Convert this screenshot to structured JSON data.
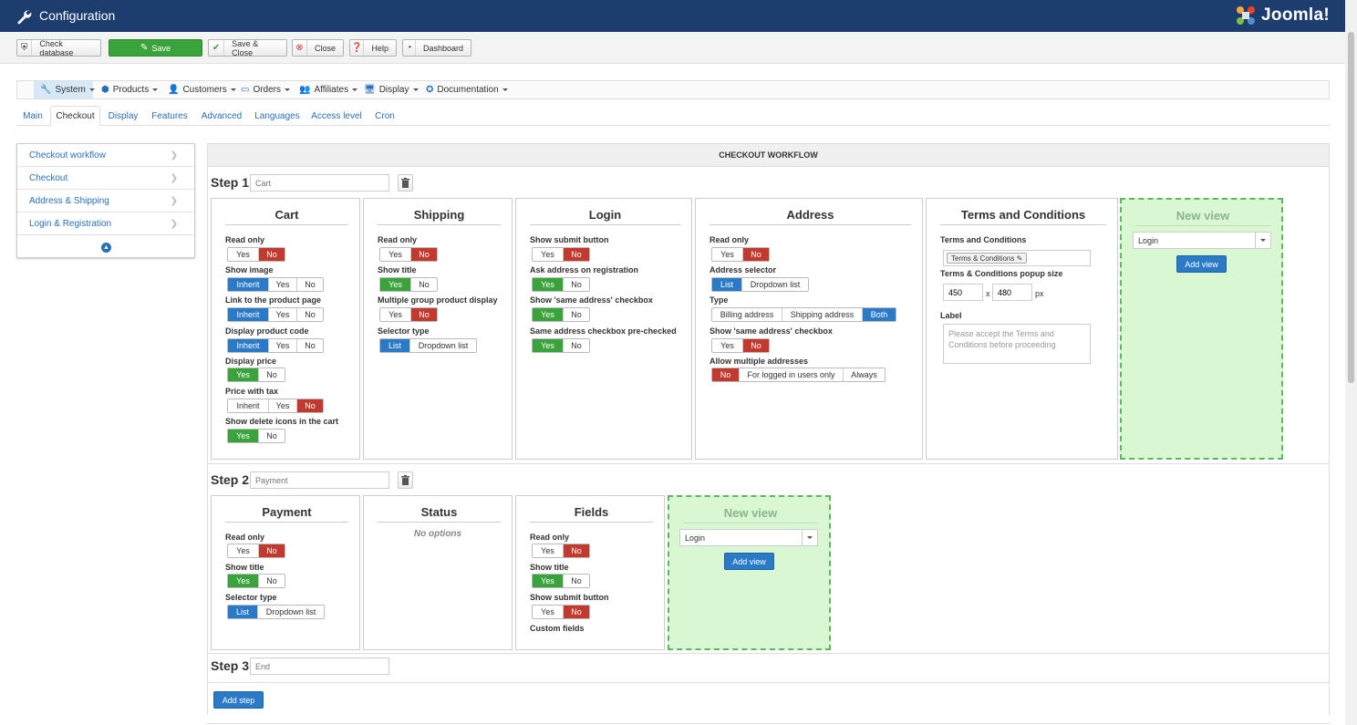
{
  "app": {
    "title": "Configuration",
    "brand": "Joomla!",
    "brand_word": "Joomla!"
  },
  "toolbar": {
    "check_database": "Check database",
    "save": "Save",
    "save_close": "Save & Close",
    "close": "Close",
    "help": "Help",
    "dashboard": "Dashboard"
  },
  "menu": {
    "items": [
      {
        "label": "System",
        "icon": "wrench-icon"
      },
      {
        "label": "Products",
        "icon": "cubes-icon"
      },
      {
        "label": "Customers",
        "icon": "user-icon"
      },
      {
        "label": "Orders",
        "icon": "credit-card-icon"
      },
      {
        "label": "Affiliates",
        "icon": "users-icon"
      },
      {
        "label": "Display",
        "icon": "desktop-icon"
      },
      {
        "label": "Documentation",
        "icon": "life-ring-icon"
      }
    ]
  },
  "tabs": [
    "Main",
    "Checkout",
    "Display",
    "Features",
    "Advanced",
    "Languages",
    "Access level",
    "Cron"
  ],
  "leftnav": [
    "Checkout workflow",
    "Checkout",
    "Address & Shipping",
    "Login & Registration"
  ],
  "workflow": {
    "header": "CHECKOUT WORKFLOW",
    "steps": [
      {
        "label": "Step 1",
        "placeholder": "Cart"
      },
      {
        "label": "Step 2",
        "placeholder": "Payment"
      },
      {
        "label": "Step 3",
        "placeholder": "End"
      }
    ],
    "add_step": "Add step"
  },
  "cards": {
    "cart": {
      "title": "Cart",
      "fields": [
        {
          "label": "Read only",
          "options": [
            "Yes",
            "No"
          ]
        },
        {
          "label": "Show image",
          "options": [
            "Inherit",
            "Yes",
            "No"
          ]
        },
        {
          "label": "Link to the product page",
          "options": [
            "Inherit",
            "Yes",
            "No"
          ]
        },
        {
          "label": "Display product code",
          "options": [
            "Inherit",
            "Yes",
            "No"
          ]
        },
        {
          "label": "Display price",
          "options": [
            "Yes",
            "No"
          ]
        },
        {
          "label": "Price with tax",
          "options": [
            "Inherit",
            "Yes",
            "No"
          ]
        },
        {
          "label": "Show delete icons in the cart",
          "options": [
            "Yes",
            "No"
          ]
        }
      ]
    },
    "shipping": {
      "title": "Shipping",
      "fields": [
        {
          "label": "Read only",
          "options": [
            "Yes",
            "No"
          ]
        },
        {
          "label": "Show title",
          "options": [
            "Yes",
            "No"
          ]
        },
        {
          "label": "Multiple group product display",
          "options": [
            "Yes",
            "No"
          ]
        },
        {
          "label": "Selector type",
          "options": [
            "List",
            "Dropdown list"
          ]
        }
      ]
    },
    "login": {
      "title": "Login",
      "fields": [
        {
          "label": "Show submit button",
          "options": [
            "Yes",
            "No"
          ]
        },
        {
          "label": "Ask address on registration",
          "options": [
            "Yes",
            "No"
          ]
        },
        {
          "label": "Show 'same address' checkbox",
          "options": [
            "Yes",
            "No"
          ]
        },
        {
          "label": "Same address checkbox pre-checked",
          "options": [
            "Yes",
            "No"
          ]
        }
      ]
    },
    "address": {
      "title": "Address",
      "fields": [
        {
          "label": "Read only",
          "options": [
            "Yes",
            "No"
          ]
        },
        {
          "label": "Address selector",
          "options": [
            "List",
            "Dropdown list"
          ]
        },
        {
          "label": "Type",
          "options": [
            "Billing address",
            "Shipping address",
            "Both"
          ]
        },
        {
          "label": "Show 'same address' checkbox",
          "options": [
            "Yes",
            "No"
          ]
        },
        {
          "label": "Allow multiple addresses",
          "options": [
            "No",
            "For logged in users only",
            "Always"
          ]
        }
      ]
    },
    "terms": {
      "title": "Terms and Conditions",
      "terms_label": "Terms and Conditions",
      "terms_chip": "Terms & Conditions",
      "popup_label": "Terms & Conditions popup size",
      "width": "450",
      "x": "x",
      "height": "480",
      "px": "px",
      "label_label": "Label",
      "label_placeholder": "Please accept the Terms and Conditions before proceeding"
    },
    "newview1": {
      "title": "New view",
      "select": "Login",
      "add": "Add view"
    },
    "payment": {
      "title": "Payment",
      "fields": [
        {
          "label": "Read only",
          "options": [
            "Yes",
            "No"
          ]
        },
        {
          "label": "Show title",
          "options": [
            "Yes",
            "No"
          ]
        },
        {
          "label": "Selector type",
          "options": [
            "List",
            "Dropdown list"
          ]
        }
      ]
    },
    "status": {
      "title": "Status",
      "no_options": "No options"
    },
    "fields": {
      "title": "Fields",
      "fields": [
        {
          "label": "Read only",
          "options": [
            "Yes",
            "No"
          ]
        },
        {
          "label": "Show title",
          "options": [
            "Yes",
            "No"
          ]
        },
        {
          "label": "Show submit button",
          "options": [
            "Yes",
            "No"
          ]
        }
      ],
      "custom_fields": "Custom fields"
    },
    "newview2": {
      "title": "New view",
      "select": "Login",
      "add": "Add view"
    }
  },
  "colors": {
    "header_bg": "#1c3d6e",
    "selected_blue": "#2a7ac8",
    "selected_red": "#c23a2f",
    "selected_green": "#3ba33b",
    "new_view_bg": "#d9f7d2",
    "link": "#2a6fb5"
  }
}
